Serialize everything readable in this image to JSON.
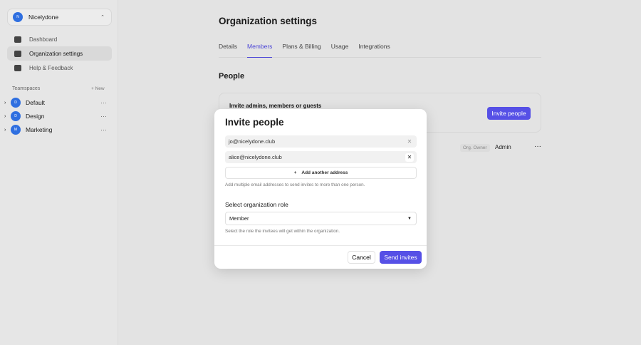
{
  "org": {
    "name": "Nicelydone",
    "initial": "N"
  },
  "nav": [
    {
      "label": "Dashboard"
    },
    {
      "label": "Organization settings"
    },
    {
      "label": "Help & Feedback"
    }
  ],
  "teamspaces": {
    "heading": "Teamspaces",
    "new_label": "+ New",
    "items": [
      {
        "name": "Default",
        "initial": "D"
      },
      {
        "name": "Design",
        "initial": "D"
      },
      {
        "name": "Marketing",
        "initial": "M"
      }
    ]
  },
  "page": {
    "title": "Organization settings",
    "tabs": [
      "Details",
      "Members",
      "Plans & Billing",
      "Usage",
      "Integrations"
    ],
    "section": "People",
    "invite_card": {
      "title": "Invite admins, members or guests",
      "button": "Invite people"
    },
    "member": {
      "badge": "Org. Owner",
      "role": "Admin"
    }
  },
  "modal": {
    "title": "Invite people",
    "emails": [
      "jo@nicelydone.club",
      "alice@nicelydone.club"
    ],
    "add_label": "Add another address",
    "email_hint": "Add multiple email addresses to send invites to more than one person.",
    "role_label": "Select organization role",
    "role_value": "Member",
    "role_hint": "Select the role the invitees will get within the organization.",
    "cancel": "Cancel",
    "send": "Send invites"
  }
}
